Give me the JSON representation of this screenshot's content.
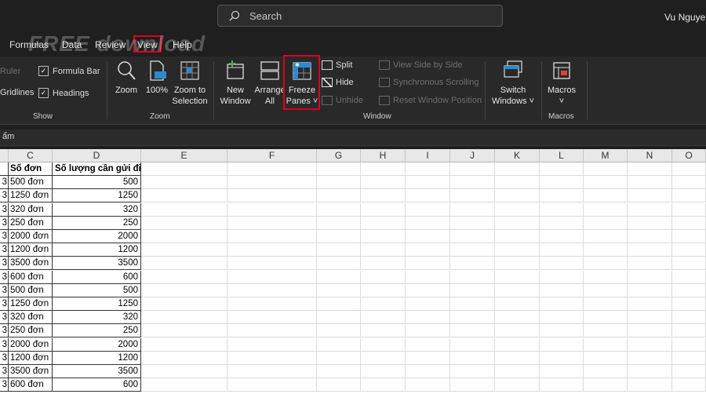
{
  "titlebar": {
    "search_placeholder": "Search",
    "user_name": "Vu Nguyen"
  },
  "menu": {
    "tabs": [
      "Formulas",
      "Data",
      "Review",
      "View",
      "Help"
    ]
  },
  "watermark": "FREE download",
  "ribbon": {
    "show": {
      "ruler": "Ruler",
      "formula_bar": "Formula Bar",
      "gridlines": "Gridlines",
      "headings": "Headings",
      "label": "Show"
    },
    "zoom": {
      "zoom": "Zoom",
      "zoom100": "100%",
      "zoom_to_selection_1": "Zoom to",
      "zoom_to_selection_2": "Selection",
      "label": "Zoom"
    },
    "window": {
      "new_window_1": "New",
      "new_window_2": "Window",
      "arrange_all_1": "Arrange",
      "arrange_all_2": "All",
      "freeze_1": "Freeze",
      "freeze_2": "Panes ˅",
      "split": "Split",
      "hide": "Hide",
      "unhide": "Unhide",
      "view_side": "View Side by Side",
      "sync_scroll": "Synchronous Scrolling",
      "reset_pos": "Reset Window Position",
      "switch_1": "Switch",
      "switch_2": "Windows ˅",
      "label": "Window"
    },
    "macros": {
      "macros_1": "Macros",
      "macros_2": "˅",
      "label": "Macros"
    }
  },
  "formula_bar_text": "ẩm",
  "columns": [
    "C",
    "D",
    "E",
    "F",
    "G",
    "H",
    "I",
    "J",
    "K",
    "L",
    "M",
    "N",
    "O"
  ],
  "header_row": {
    "c": "Số đơn",
    "d": "Số lượng cần gửi đi"
  },
  "rows": [
    {
      "b": "3",
      "c": "500 đơn",
      "d": "500"
    },
    {
      "b": "3",
      "c": "1250 đơn",
      "d": "1250"
    },
    {
      "b": "3",
      "c": "320 đơn",
      "d": "320"
    },
    {
      "b": "3",
      "c": "250 đơn",
      "d": "250"
    },
    {
      "b": "3",
      "c": "2000 đơn",
      "d": "2000"
    },
    {
      "b": "3",
      "c": "1200 đơn",
      "d": "1200"
    },
    {
      "b": "3",
      "c": "3500 đơn",
      "d": "3500"
    },
    {
      "b": "3",
      "c": "600 đơn",
      "d": "600"
    },
    {
      "b": "3",
      "c": "500 đơn",
      "d": "500"
    },
    {
      "b": "3",
      "c": "1250 đơn",
      "d": "1250"
    },
    {
      "b": "3",
      "c": "320 đơn",
      "d": "320"
    },
    {
      "b": "3",
      "c": "250 đơn",
      "d": "250"
    },
    {
      "b": "3",
      "c": "2000 đơn",
      "d": "2000"
    },
    {
      "b": "3",
      "c": "1200 đơn",
      "d": "1200"
    },
    {
      "b": "3",
      "c": "3500 đơn",
      "d": "3500"
    },
    {
      "b": "3",
      "c": "600 đơn",
      "d": "600"
    }
  ]
}
